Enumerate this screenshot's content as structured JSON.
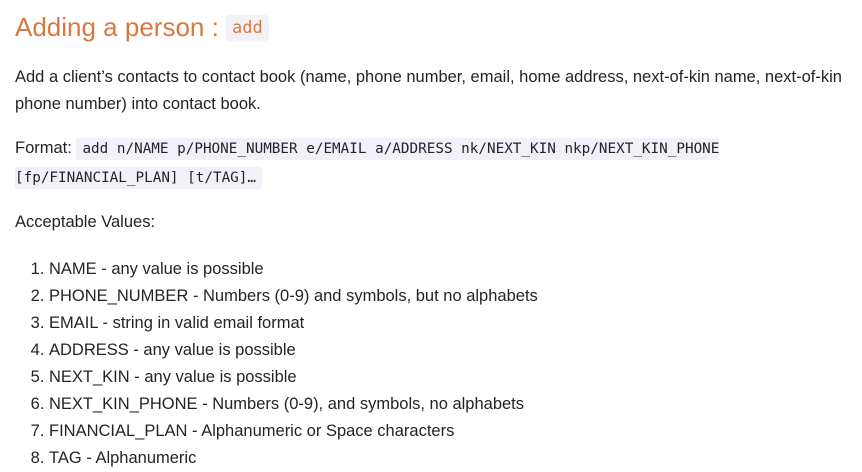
{
  "section": {
    "title_text": "Adding a person :",
    "title_code": "add"
  },
  "intro": "Add a client’s contacts to contact book (name, phone number, email, home address, next-of-kin name, next-of-kin phone number) into contact book.",
  "format": {
    "label": "Format:",
    "code": "add n/NAME p/PHONE_NUMBER e/EMAIL a/ADDRESS nk/NEXT_KIN nkp/NEXT_KIN_PHONE [fp/FINANCIAL_PLAN] [t/TAG]…"
  },
  "acceptable_label": "Acceptable Values:",
  "values": [
    "NAME - any value is possible",
    "PHONE_NUMBER - Numbers (0-9) and symbols, but no alphabets",
    "EMAIL - string in valid email format",
    "ADDRESS - any value is possible",
    "NEXT_KIN - any value is possible",
    "NEXT_KIN_PHONE - Numbers (0-9), and symbols, no alphabets",
    "FINANCIAL_PLAN - Alphanumeric or Space characters",
    "TAG - Alphanumeric"
  ],
  "colors": {
    "heading": "#d9783f",
    "code_background": "#f3f1f8",
    "text": "#212529"
  }
}
